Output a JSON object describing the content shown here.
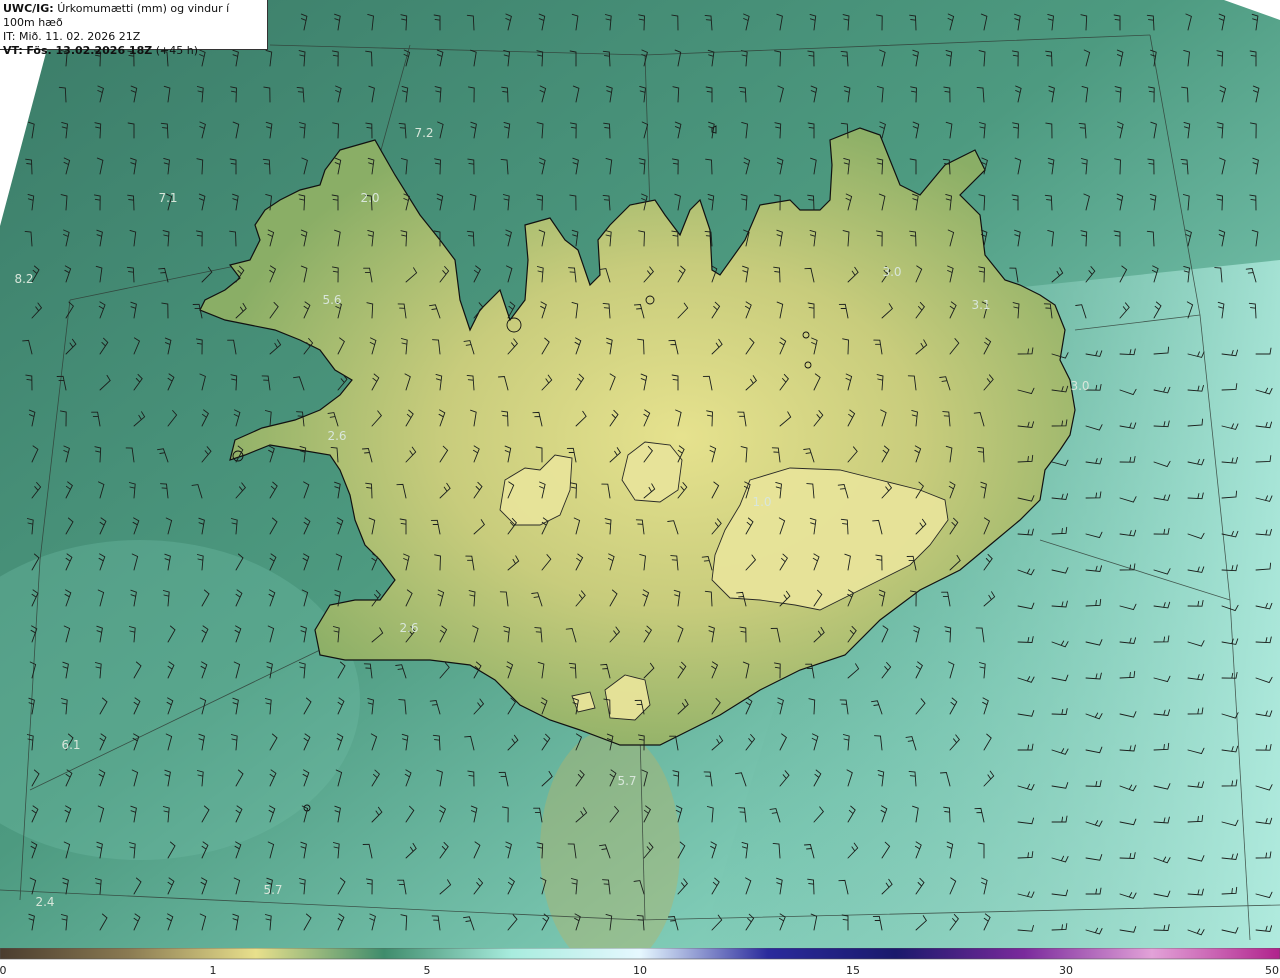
{
  "header": {
    "model": "UWC/IG:",
    "title": "Úrkomumætti (mm) og vindur í 100m hæð",
    "init_time": "IT: Mið. 11. 02. 2026 21Z",
    "valid_prefix": "VT:",
    "valid_time": "Fös. 13.02.2026 18Z",
    "lead": "(+45 h)"
  },
  "map_labels": [
    "7.2",
    "7.1",
    "2.0",
    "8.2",
    "5.6",
    "3.0",
    "3.1",
    "3.0",
    "2.6",
    "1.0",
    "2.6",
    "6.1",
    "5.7",
    "5.7",
    "2.4"
  ],
  "colorbar": {
    "ticks": [
      "0",
      "1",
      "5",
      "10",
      "15",
      "30",
      "50"
    ],
    "colors": [
      "#4a3c2e",
      "#8a7a52",
      "#e8e08c",
      "#3f8c6c",
      "#a8ecde",
      "#e6f8ff",
      "#2a2a9c",
      "#1a1a6c",
      "#7a2a9c",
      "#e2a2d8",
      "#b0228c"
    ]
  },
  "colors": {
    "sea_deep": "#3e7f6b",
    "sea_light": "#8fd6c4",
    "land_low": "#6e9c5c",
    "land_high": "#e2e08a",
    "coast": "#111111"
  }
}
